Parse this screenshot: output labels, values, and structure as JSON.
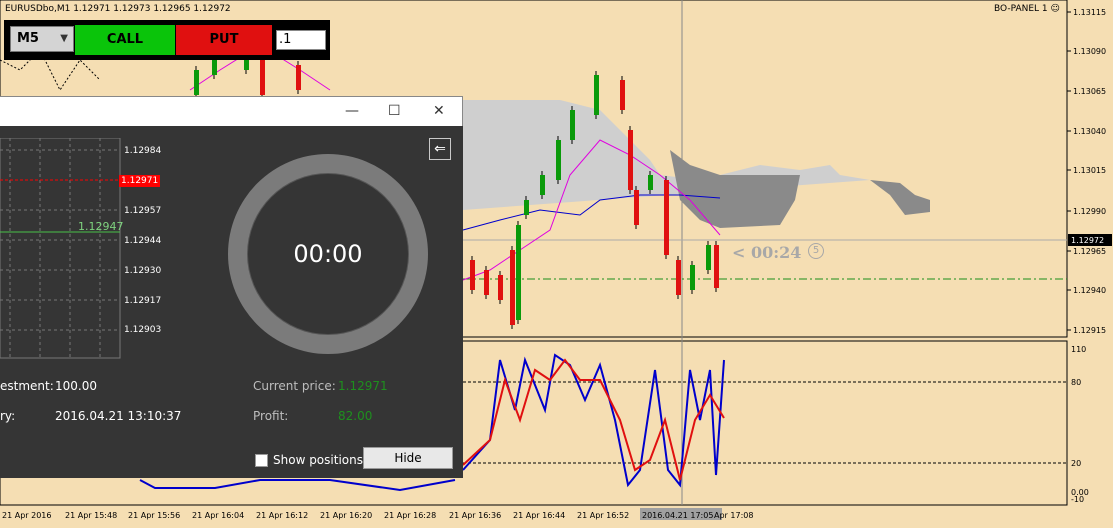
{
  "chart": {
    "symbol_line": "EURUSDbo,M1  1.12971 1.12973 1.12965 1.12972",
    "panel_title": "BO-PANEL 1",
    "countdown": "< 00:24",
    "countdown_mark": "5",
    "current_price_label": "1.12972",
    "price_ticks": [
      "1.13115",
      "1.13090",
      "1.13065",
      "1.13040",
      "1.13015",
      "1.12990",
      "1.12965",
      "1.12940",
      "1.12915"
    ],
    "osc_ticks": [
      "110",
      "80",
      "20",
      "0.00",
      "-10"
    ],
    "time_ticks": [
      "21 Apr 2016",
      "21 Apr 15:48",
      "21 Apr 15:56",
      "21 Apr 16:04",
      "21 Apr 16:12",
      "21 Apr 16:20",
      "21 Apr 16:28",
      "21 Apr 16:36",
      "21 Apr 16:44",
      "21 Apr 16:52",
      "2016.04.21 17:05",
      "Apr 17:08"
    ]
  },
  "toolbar": {
    "timeframe": "M5",
    "call_label": "CALL",
    "put_label": "PUT",
    "amount": ".1",
    "colors": {
      "call": "#0ac40a",
      "put": "#e01010"
    }
  },
  "dialog": {
    "timer": "00:00",
    "mini_ticks": [
      "1.12984",
      "1.12971",
      "1.12957",
      "1.12944",
      "1.12930",
      "1.12917",
      "1.12903"
    ],
    "mini_green_label": "1.12947",
    "investment_label": "estment:",
    "investment_value": "100.00",
    "expiry_label": "ry:",
    "expiry_value": "2016.04.21 13:10:37",
    "current_price_label": "Current price:",
    "current_price_value": "1.12971",
    "profit_label": "Profit:",
    "profit_value": "82.00",
    "show_positions_label": "Show positions",
    "hide_label": "Hide"
  }
}
